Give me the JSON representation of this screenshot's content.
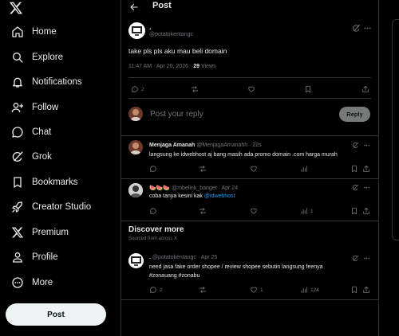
{
  "sidebar": {
    "logo": "x-logo-icon",
    "items": [
      {
        "label": "Home",
        "icon": "home-icon"
      },
      {
        "label": "Explore",
        "icon": "search-icon"
      },
      {
        "label": "Notifications",
        "icon": "bell-icon"
      },
      {
        "label": "Follow",
        "icon": "person-add-icon"
      },
      {
        "label": "Chat",
        "icon": "chat-bubble-icon"
      },
      {
        "label": "Grok",
        "icon": "grok-icon"
      },
      {
        "label": "Bookmarks",
        "icon": "bookmark-icon"
      },
      {
        "label": "Creator Studio",
        "icon": "rocket-icon"
      },
      {
        "label": "Premium",
        "icon": "x-logo-icon"
      },
      {
        "label": "Profile",
        "icon": "person-icon"
      },
      {
        "label": "More",
        "icon": "more-circle-icon"
      }
    ],
    "post_button": "Post"
  },
  "header": {
    "title": "Post"
  },
  "main_post": {
    "author_name": ".",
    "author_handle": "@potatokentangc",
    "text": "take pls pls aku mau beli domain",
    "time": "11:47 AM · Apr 20, 2026 · ",
    "views_count": "29",
    "views_label": " Views",
    "replies": "2"
  },
  "reply_box": {
    "placeholder": "Post your reply",
    "button": "Reply"
  },
  "replies": [
    {
      "name": "Menjaga Amanah",
      "handle_time": " @MenjagaAmanahh · 22s",
      "text": "langsung ke idwebhost aj bang masih ada promo domain .com harga murah"
    },
    {
      "name": "🍉🍉🍉",
      "handle_time": " @mbelink_banget · Apr 24",
      "text": "coba tanya kesini kak ",
      "mention": "@idwebhost",
      "views": "1"
    }
  ],
  "discover": {
    "title": "Discover more",
    "subtitle": "Sourced from across X",
    "post": {
      "name": ".",
      "handle_time": " @potatokentangc · Apr 25",
      "text": "need jasa fake order shopee / review shopee sebutin langsung feenya",
      "hashtags": "#zonauang #zonabu",
      "replies": "2",
      "likes": "1",
      "views": "124"
    }
  },
  "colors": {
    "background": "#000000",
    "accent": "#1d9bf0",
    "text": "#e7e9ea",
    "muted": "#71767b",
    "border": "#2f3336"
  }
}
